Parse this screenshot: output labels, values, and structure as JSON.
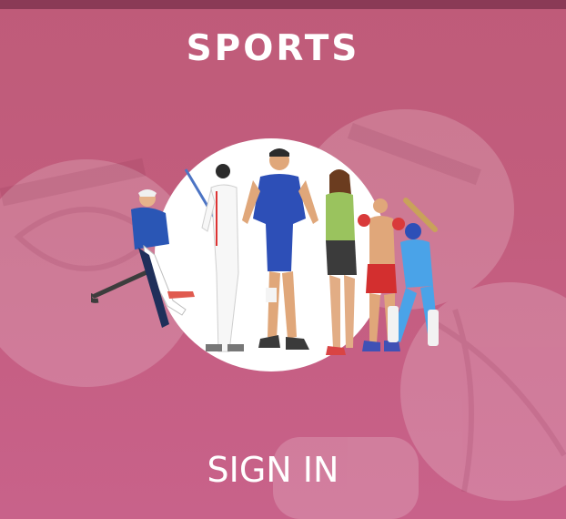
{
  "app": {
    "title": "SPORTS"
  },
  "hero": {
    "illustration": "sports-athletes-illustration"
  },
  "actions": {
    "signin_label": "SIGN IN"
  },
  "colors": {
    "background": "#c25d7d",
    "status_bar": "#8a3a56",
    "text": "#ffffff",
    "circle": "#ffffff"
  }
}
